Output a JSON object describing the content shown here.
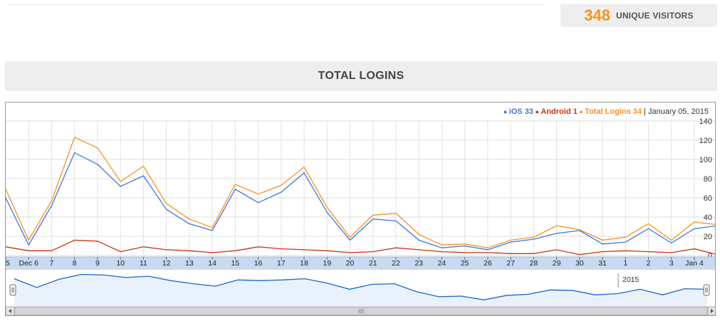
{
  "stats": {
    "unique_visitors_count": "348",
    "unique_visitors_label": "UNIQUE VISITORS"
  },
  "section": {
    "title": "TOTAL LOGINS"
  },
  "legend": {
    "items": [
      {
        "label": "iOS 33",
        "color": "#3c78d8"
      },
      {
        "label": "Android 1",
        "color": "#cc3311"
      },
      {
        "label": "Total Logins 34",
        "color": "#f7931e"
      }
    ],
    "date": "January 05, 2015"
  },
  "navigator": {
    "year_label": "2015"
  },
  "chart_data": {
    "type": "line",
    "x": [
      "Dec 5",
      "Dec 6",
      "Dec 7",
      "Dec 8",
      "Dec 9",
      "Dec 10",
      "Dec 11",
      "Dec 12",
      "Dec 13",
      "Dec 14",
      "Dec 15",
      "Dec 16",
      "Dec 17",
      "Dec 18",
      "Dec 19",
      "Dec 20",
      "Dec 21",
      "Dec 22",
      "Dec 23",
      "Dec 24",
      "Dec 25",
      "Dec 26",
      "Dec 27",
      "Dec 28",
      "Dec 29",
      "Dec 30",
      "Dec 31",
      "Jan 1",
      "Jan 2",
      "Jan 3",
      "Jan 4",
      "Jan 5"
    ],
    "x_tick_labels": [
      "5",
      "Dec 6",
      "7",
      "8",
      "9",
      "10",
      "11",
      "12",
      "13",
      "14",
      "15",
      "16",
      "17",
      "18",
      "19",
      "20",
      "21",
      "22",
      "23",
      "24",
      "25",
      "26",
      "27",
      "28",
      "29",
      "30",
      "31",
      "1",
      "2",
      "3",
      "Jan 4",
      ""
    ],
    "series": [
      {
        "name": "iOS",
        "color": "#3c78d8",
        "values": [
          60,
          11,
          52,
          107,
          95,
          72,
          83,
          48,
          33,
          26,
          69,
          55,
          66,
          86,
          45,
          16,
          38,
          36,
          16,
          8,
          10,
          6,
          14,
          17,
          23,
          26,
          12,
          14,
          28,
          13,
          28,
          31
        ]
      },
      {
        "name": "Android",
        "color": "#cc3311",
        "values": [
          9,
          5,
          5,
          16,
          15,
          4,
          9,
          6,
          5,
          3,
          5,
          9,
          7,
          6,
          5,
          3,
          4,
          8,
          6,
          4,
          3,
          3,
          2,
          2,
          6,
          1,
          4,
          5,
          4,
          3,
          7,
          1
        ]
      },
      {
        "name": "Total Logins",
        "color": "#f7931e",
        "values": [
          69,
          16,
          57,
          123,
          112,
          77,
          93,
          54,
          38,
          29,
          74,
          64,
          73,
          92,
          50,
          19,
          42,
          44,
          22,
          11,
          12,
          8,
          16,
          19,
          31,
          27,
          16,
          19,
          33,
          16,
          35,
          32
        ]
      }
    ],
    "navigator_values": [
      54,
      40,
      53,
      61,
      60,
      56,
      58,
      51,
      46,
      42,
      52,
      51,
      52,
      54,
      47,
      37,
      45,
      46,
      33,
      25,
      26,
      20,
      27,
      29,
      36,
      35,
      28,
      30,
      37,
      28,
      38,
      37
    ],
    "ylim": [
      0,
      140
    ],
    "y_ticks": [
      0,
      20,
      40,
      60,
      80,
      100,
      120,
      140
    ],
    "grid": true,
    "legend_position": "top-right"
  }
}
